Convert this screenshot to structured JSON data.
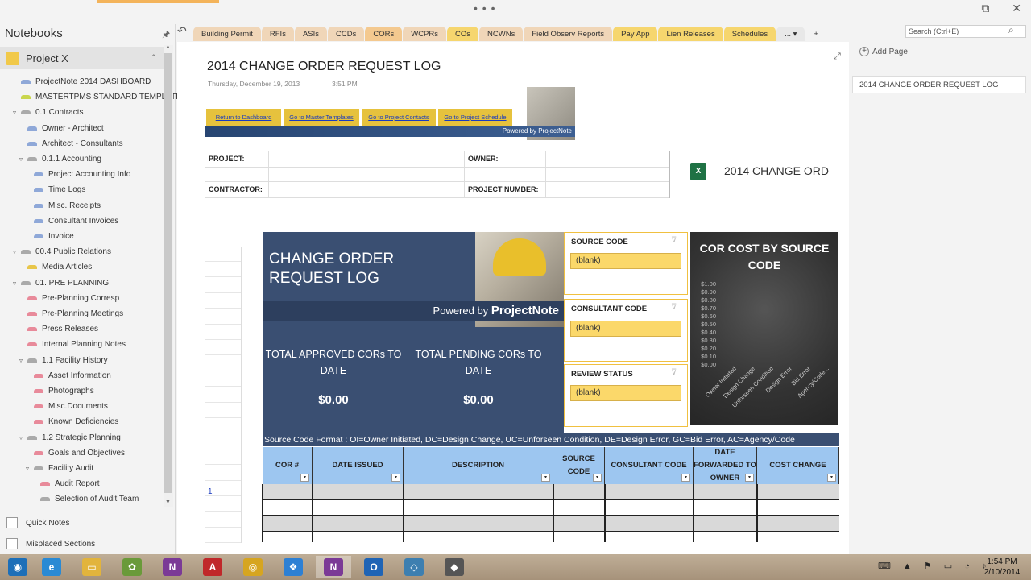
{
  "window": {
    "dots": "• • •",
    "restore": "⧉",
    "close": "✕"
  },
  "left_panel": {
    "title": "Notebooks",
    "pin": "🖈",
    "notebook": "Project X",
    "items": [
      {
        "label": "ProjectNote 2014 DASHBOARD",
        "color": "#8fa8d8",
        "indent": 0,
        "exp": ""
      },
      {
        "label": "MASTERTPMS STANDARD TEMPLATES",
        "color": "#c9d64e",
        "indent": 0,
        "exp": ""
      },
      {
        "label": "0.1 Contracts",
        "color": "#aaa",
        "indent": 0,
        "exp": "▿"
      },
      {
        "label": "Owner - Architect",
        "color": "#8fa8d8",
        "indent": 1,
        "exp": ""
      },
      {
        "label": "Architect - Consultants",
        "color": "#8fa8d8",
        "indent": 1,
        "exp": ""
      },
      {
        "label": "0.1.1 Accounting",
        "color": "#aaa",
        "indent": 1,
        "exp": "▿"
      },
      {
        "label": "Project Accounting Info",
        "color": "#8fa8d8",
        "indent": 2,
        "exp": ""
      },
      {
        "label": "Time Logs",
        "color": "#8fa8d8",
        "indent": 2,
        "exp": ""
      },
      {
        "label": "Misc. Receipts",
        "color": "#8fa8d8",
        "indent": 2,
        "exp": ""
      },
      {
        "label": "Consultant Invoices",
        "color": "#8fa8d8",
        "indent": 2,
        "exp": ""
      },
      {
        "label": "Invoice",
        "color": "#8fa8d8",
        "indent": 2,
        "exp": ""
      },
      {
        "label": "00.4 Public Relations",
        "color": "#aaa",
        "indent": 0,
        "exp": "▿"
      },
      {
        "label": "Media Articles",
        "color": "#e8c64a",
        "indent": 1,
        "exp": ""
      },
      {
        "label": "01. PRE PLANNING",
        "color": "#aaa",
        "indent": 0,
        "exp": "▿"
      },
      {
        "label": "Pre-Planning Corresp",
        "color": "#e88a9a",
        "indent": 1,
        "exp": ""
      },
      {
        "label": "Pre-Planning Meetings",
        "color": "#e88a9a",
        "indent": 1,
        "exp": ""
      },
      {
        "label": "Press Releases",
        "color": "#e88a9a",
        "indent": 1,
        "exp": ""
      },
      {
        "label": "Internal Planning Notes",
        "color": "#e88a9a",
        "indent": 1,
        "exp": ""
      },
      {
        "label": "1.1 Facility History",
        "color": "#aaa",
        "indent": 1,
        "exp": "▿"
      },
      {
        "label": "Asset Information",
        "color": "#e88a9a",
        "indent": 2,
        "exp": ""
      },
      {
        "label": "Photographs",
        "color": "#e88a9a",
        "indent": 2,
        "exp": ""
      },
      {
        "label": "Misc.Documents",
        "color": "#e88a9a",
        "indent": 2,
        "exp": ""
      },
      {
        "label": "Known Deficiencies",
        "color": "#e88a9a",
        "indent": 2,
        "exp": ""
      },
      {
        "label": "1.2 Strategic Planning",
        "color": "#aaa",
        "indent": 1,
        "exp": "▿"
      },
      {
        "label": "Goals and Objectives",
        "color": "#e88a9a",
        "indent": 2,
        "exp": ""
      },
      {
        "label": "Facility Audit",
        "color": "#aaa",
        "indent": 2,
        "exp": "▿"
      },
      {
        "label": "Audit Report",
        "color": "#e88a9a",
        "indent": 3,
        "exp": ""
      },
      {
        "label": "Selection of Audit Team",
        "color": "#aaa",
        "indent": 3,
        "exp": ""
      }
    ],
    "quick_notes": "Quick Notes",
    "misplaced": "Misplaced Sections"
  },
  "tabs": [
    {
      "label": "Building Permit",
      "color": "#f0d6b8"
    },
    {
      "label": "RFIs",
      "color": "#f0d6b8"
    },
    {
      "label": "ASIs",
      "color": "#f0d6b8"
    },
    {
      "label": "CCDs",
      "color": "#f0d6b8"
    },
    {
      "label": "CORs",
      "color": "#f4c98f"
    },
    {
      "label": "WCPRs",
      "color": "#f0d6b8"
    },
    {
      "label": "COs",
      "color": "#f6d66e"
    },
    {
      "label": "NCWNs",
      "color": "#f0d6b8"
    },
    {
      "label": "Field Observ Reports",
      "color": "#f0d6b8"
    },
    {
      "label": "Pay App",
      "color": "#f6d66e"
    },
    {
      "label": "Lien Releases",
      "color": "#f6d66e"
    },
    {
      "label": "Schedules",
      "color": "#f6d66e"
    },
    {
      "label": "... ▾",
      "color": "#e8e8e8"
    },
    {
      "label": "+",
      "color": "#f3f3f3"
    }
  ],
  "undo": "↶",
  "search": {
    "placeholder": "Search (Ctrl+E)",
    "icon": "⌕"
  },
  "pages_panel": {
    "add_label": "Add Page",
    "page": "2014 CHANGE ORDER REQUEST LOG"
  },
  "page": {
    "title": "2014 CHANGE ORDER REQUEST LOG",
    "date": "Thursday, December 19, 2013",
    "time": "3:51 PM",
    "expand": "⤢",
    "nav": [
      "Return to Dashboard",
      "Go to Master Templates",
      "Go to Project Contacts",
      "Go to Project Schedule"
    ],
    "powered_small": "Powered by ProjectNote",
    "project_label": "PROJECT:",
    "owner_label": "OWNER:",
    "contractor_label": "CONTRACTOR:",
    "project_number_label": "PROJECT NUMBER:",
    "attachment_icon": "X",
    "attachment": "2014 CHANGE ORD"
  },
  "sheet": {
    "banner_title": "CHANGE ORDER REQUEST LOG",
    "powered_prefix": "Powered by",
    "powered_brand": "ProjectNote",
    "total_approved_label": "TOTAL APPROVED CORs TO DATE",
    "total_approved": "$0.00",
    "total_pending_label": "TOTAL PENDING CORs TO DATE",
    "total_pending": "$0.00",
    "slicers": [
      {
        "title": "SOURCE CODE",
        "item": "(blank)"
      },
      {
        "title": "CONSULTANT CODE",
        "item": "(blank)"
      },
      {
        "title": "REVIEW STATUS",
        "item": "(blank)"
      }
    ],
    "filter_icon": "⊽",
    "format": "Source Code Format : OI=Owner Initiated, DC=Design Change, UC=Unforseen Condition, DE=Design Error, GC=Bid Error, AC=Agency/Code",
    "columns": [
      "COR #",
      "DATE ISSUED",
      "DESCRIPTION",
      "SOURCE CODE",
      "CONSULTANT CODE",
      "DATE FORWARDED TO OWNER",
      "COST CHANGE"
    ],
    "dropdown": "▾",
    "row_link": "1"
  },
  "chart_data": {
    "type": "bar",
    "title": "COR COST BY SOURCE CODE",
    "categories": [
      "Owner Initiated",
      "Design Change",
      "Unforseen Condition",
      "Design Error",
      "Bid Error",
      "Agency/Code..."
    ],
    "values": [
      0,
      0,
      0,
      0,
      0,
      0
    ],
    "yticks": [
      "$1.00",
      "$0.90",
      "$0.80",
      "$0.70",
      "$0.60",
      "$0.50",
      "$0.40",
      "$0.30",
      "$0.20",
      "$0.10",
      "$0.00"
    ],
    "ylim": [
      0,
      1
    ],
    "grid": false
  },
  "taskbar": {
    "apps": [
      {
        "name": "start",
        "glyph": "◉",
        "color": "#1d6fb8"
      },
      {
        "name": "ie",
        "glyph": "e",
        "color": "#2a8ad4"
      },
      {
        "name": "explorer",
        "glyph": "▭",
        "color": "#e2b43c"
      },
      {
        "name": "colors",
        "glyph": "✿",
        "color": "#6a9a3a"
      },
      {
        "name": "onenote",
        "glyph": "N",
        "color": "#7b3a96"
      },
      {
        "name": "acrobat",
        "glyph": "A",
        "color": "#c0282a"
      },
      {
        "name": "chrome",
        "glyph": "◎",
        "color": "#d6a520"
      },
      {
        "name": "dropbox",
        "glyph": "❖",
        "color": "#2d80d4"
      },
      {
        "name": "onenote-active",
        "glyph": "N",
        "color": "#7b3a96"
      },
      {
        "name": "outlook",
        "glyph": "O",
        "color": "#1f64b5"
      },
      {
        "name": "network",
        "glyph": "◇",
        "color": "#3d7fb0"
      },
      {
        "name": "app",
        "glyph": "◆",
        "color": "#555555"
      }
    ],
    "tray": "⌨ ▲ ⚑ ▭ ◔ ♪",
    "time": "1:54 PM",
    "date": "2/10/2014"
  }
}
